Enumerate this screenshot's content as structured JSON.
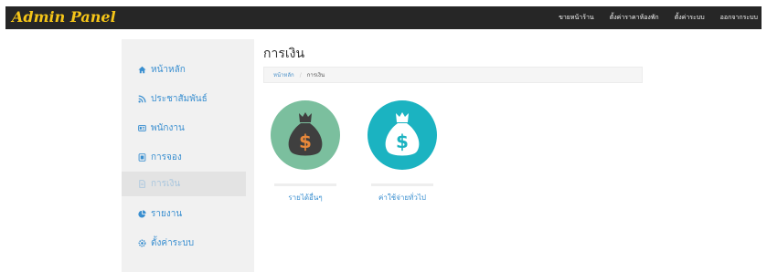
{
  "app": {
    "brand": "Admin Panel"
  },
  "topnav": [
    {
      "label": "ขายหน้าร้าน"
    },
    {
      "label": "ตั้งค่าราคาห้องพัก"
    },
    {
      "label": "ตั้งค่าระบบ"
    },
    {
      "label": "ออกจากระบบ"
    }
  ],
  "sidebar": {
    "items": [
      {
        "label": "หน้าหลัก",
        "icon": "home-icon"
      },
      {
        "label": "ประชาสัมพันธ์",
        "icon": "rss-icon"
      },
      {
        "label": "พนักงาน",
        "icon": "id-card-icon"
      },
      {
        "label": "การจอง",
        "icon": "booking-icon"
      },
      {
        "label": "การเงิน",
        "icon": "file-icon",
        "active": true
      },
      {
        "label": "รายงาน",
        "icon": "chart-icon"
      },
      {
        "label": "ตั้งค่าระบบ",
        "icon": "gear-icon"
      }
    ]
  },
  "main": {
    "title": "การเงิน",
    "breadcrumb": {
      "home": "หน้าหลัก",
      "current": "การเงิน"
    },
    "cards": [
      {
        "label": "รายได้อื่นๆ",
        "color": "#7bbf9e",
        "bag_color": "#3f3f3f",
        "icon": "money-bag-icon"
      },
      {
        "label": "ค่าใช้จ่ายทั่วไป",
        "color": "#1bb3c1",
        "bag_color": "#ffffff",
        "icon": "money-bag-icon"
      }
    ]
  },
  "colors": {
    "navbar": "#262626",
    "brand": "#f5c518",
    "link": "#3a8fd0",
    "sidebar_bg": "#f1f1f1"
  }
}
